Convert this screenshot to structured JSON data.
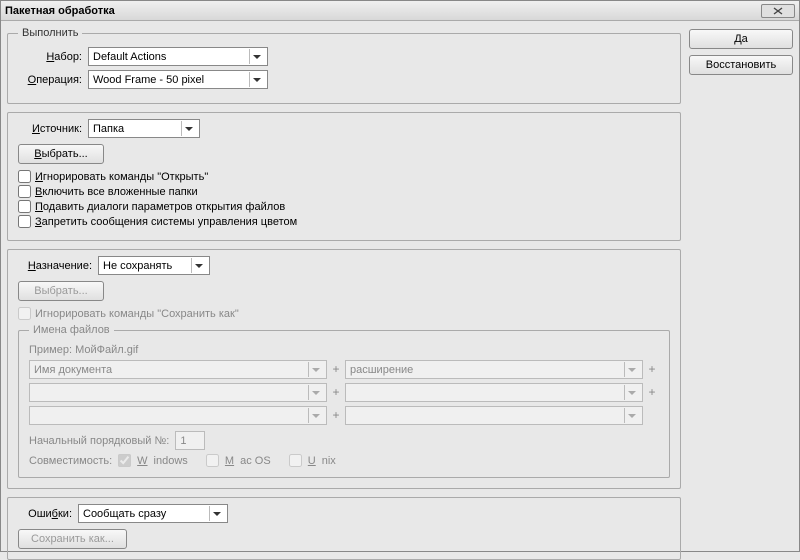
{
  "title": "Пакетная обработка",
  "buttons": {
    "ok": "Да",
    "reset": "Восстановить"
  },
  "play": {
    "legend": "Выполнить",
    "set_label": "Набор:",
    "set_value": "Default Actions",
    "action_label": "Операция:",
    "action_value": "Wood Frame - 50 pixel"
  },
  "source": {
    "label": "Источник:",
    "value": "Папка",
    "choose": "Выбрать...",
    "chk_override_open": "Игнорировать команды \"Открыть\"",
    "chk_include_sub": "Включить все вложенные папки",
    "chk_suppress_open_opts": "Подавить диалоги параметров открытия файлов",
    "chk_suppress_color": "Запретить сообщения системы управления цветом"
  },
  "dest": {
    "label": "Назначение:",
    "value": "Не сохранять",
    "choose": "Выбрать...",
    "chk_override_save": "Игнорировать команды \"Сохранить как\"",
    "filenames_legend": "Имена файлов",
    "example_label": "Пример:",
    "example_value": "МойФайл.gif",
    "fname_parts": [
      "Имя документа",
      "",
      "расширение",
      "",
      "",
      ""
    ],
    "start_serial_label": "Начальный порядковый №:",
    "start_serial_value": "1",
    "compat_label": "Совместимость:",
    "compat_win": "Windows",
    "compat_mac": "Mac OS",
    "compat_unix": "Unix"
  },
  "errors": {
    "label": "Ошибки:",
    "value": "Сообщать сразу",
    "save_as": "Сохранить как..."
  }
}
